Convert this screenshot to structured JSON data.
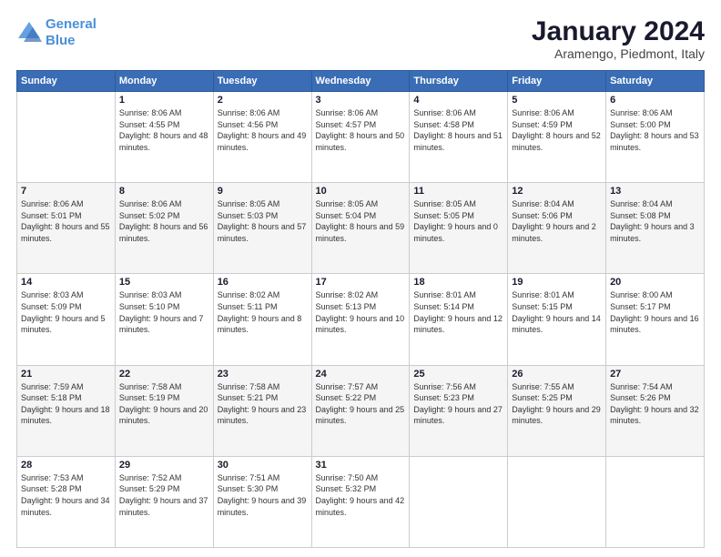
{
  "logo": {
    "line1": "General",
    "line2": "Blue"
  },
  "title": "January 2024",
  "subtitle": "Aramengo, Piedmont, Italy",
  "weekdays": [
    "Sunday",
    "Monday",
    "Tuesday",
    "Wednesday",
    "Thursday",
    "Friday",
    "Saturday"
  ],
  "weeks": [
    [
      {
        "day": "",
        "sunrise": "",
        "sunset": "",
        "daylight": ""
      },
      {
        "day": "1",
        "sunrise": "Sunrise: 8:06 AM",
        "sunset": "Sunset: 4:55 PM",
        "daylight": "Daylight: 8 hours and 48 minutes."
      },
      {
        "day": "2",
        "sunrise": "Sunrise: 8:06 AM",
        "sunset": "Sunset: 4:56 PM",
        "daylight": "Daylight: 8 hours and 49 minutes."
      },
      {
        "day": "3",
        "sunrise": "Sunrise: 8:06 AM",
        "sunset": "Sunset: 4:57 PM",
        "daylight": "Daylight: 8 hours and 50 minutes."
      },
      {
        "day": "4",
        "sunrise": "Sunrise: 8:06 AM",
        "sunset": "Sunset: 4:58 PM",
        "daylight": "Daylight: 8 hours and 51 minutes."
      },
      {
        "day": "5",
        "sunrise": "Sunrise: 8:06 AM",
        "sunset": "Sunset: 4:59 PM",
        "daylight": "Daylight: 8 hours and 52 minutes."
      },
      {
        "day": "6",
        "sunrise": "Sunrise: 8:06 AM",
        "sunset": "Sunset: 5:00 PM",
        "daylight": "Daylight: 8 hours and 53 minutes."
      }
    ],
    [
      {
        "day": "7",
        "sunrise": "Sunrise: 8:06 AM",
        "sunset": "Sunset: 5:01 PM",
        "daylight": "Daylight: 8 hours and 55 minutes."
      },
      {
        "day": "8",
        "sunrise": "Sunrise: 8:06 AM",
        "sunset": "Sunset: 5:02 PM",
        "daylight": "Daylight: 8 hours and 56 minutes."
      },
      {
        "day": "9",
        "sunrise": "Sunrise: 8:05 AM",
        "sunset": "Sunset: 5:03 PM",
        "daylight": "Daylight: 8 hours and 57 minutes."
      },
      {
        "day": "10",
        "sunrise": "Sunrise: 8:05 AM",
        "sunset": "Sunset: 5:04 PM",
        "daylight": "Daylight: 8 hours and 59 minutes."
      },
      {
        "day": "11",
        "sunrise": "Sunrise: 8:05 AM",
        "sunset": "Sunset: 5:05 PM",
        "daylight": "Daylight: 9 hours and 0 minutes."
      },
      {
        "day": "12",
        "sunrise": "Sunrise: 8:04 AM",
        "sunset": "Sunset: 5:06 PM",
        "daylight": "Daylight: 9 hours and 2 minutes."
      },
      {
        "day": "13",
        "sunrise": "Sunrise: 8:04 AM",
        "sunset": "Sunset: 5:08 PM",
        "daylight": "Daylight: 9 hours and 3 minutes."
      }
    ],
    [
      {
        "day": "14",
        "sunrise": "Sunrise: 8:03 AM",
        "sunset": "Sunset: 5:09 PM",
        "daylight": "Daylight: 9 hours and 5 minutes."
      },
      {
        "day": "15",
        "sunrise": "Sunrise: 8:03 AM",
        "sunset": "Sunset: 5:10 PM",
        "daylight": "Daylight: 9 hours and 7 minutes."
      },
      {
        "day": "16",
        "sunrise": "Sunrise: 8:02 AM",
        "sunset": "Sunset: 5:11 PM",
        "daylight": "Daylight: 9 hours and 8 minutes."
      },
      {
        "day": "17",
        "sunrise": "Sunrise: 8:02 AM",
        "sunset": "Sunset: 5:13 PM",
        "daylight": "Daylight: 9 hours and 10 minutes."
      },
      {
        "day": "18",
        "sunrise": "Sunrise: 8:01 AM",
        "sunset": "Sunset: 5:14 PM",
        "daylight": "Daylight: 9 hours and 12 minutes."
      },
      {
        "day": "19",
        "sunrise": "Sunrise: 8:01 AM",
        "sunset": "Sunset: 5:15 PM",
        "daylight": "Daylight: 9 hours and 14 minutes."
      },
      {
        "day": "20",
        "sunrise": "Sunrise: 8:00 AM",
        "sunset": "Sunset: 5:17 PM",
        "daylight": "Daylight: 9 hours and 16 minutes."
      }
    ],
    [
      {
        "day": "21",
        "sunrise": "Sunrise: 7:59 AM",
        "sunset": "Sunset: 5:18 PM",
        "daylight": "Daylight: 9 hours and 18 minutes."
      },
      {
        "day": "22",
        "sunrise": "Sunrise: 7:58 AM",
        "sunset": "Sunset: 5:19 PM",
        "daylight": "Daylight: 9 hours and 20 minutes."
      },
      {
        "day": "23",
        "sunrise": "Sunrise: 7:58 AM",
        "sunset": "Sunset: 5:21 PM",
        "daylight": "Daylight: 9 hours and 23 minutes."
      },
      {
        "day": "24",
        "sunrise": "Sunrise: 7:57 AM",
        "sunset": "Sunset: 5:22 PM",
        "daylight": "Daylight: 9 hours and 25 minutes."
      },
      {
        "day": "25",
        "sunrise": "Sunrise: 7:56 AM",
        "sunset": "Sunset: 5:23 PM",
        "daylight": "Daylight: 9 hours and 27 minutes."
      },
      {
        "day": "26",
        "sunrise": "Sunrise: 7:55 AM",
        "sunset": "Sunset: 5:25 PM",
        "daylight": "Daylight: 9 hours and 29 minutes."
      },
      {
        "day": "27",
        "sunrise": "Sunrise: 7:54 AM",
        "sunset": "Sunset: 5:26 PM",
        "daylight": "Daylight: 9 hours and 32 minutes."
      }
    ],
    [
      {
        "day": "28",
        "sunrise": "Sunrise: 7:53 AM",
        "sunset": "Sunset: 5:28 PM",
        "daylight": "Daylight: 9 hours and 34 minutes."
      },
      {
        "day": "29",
        "sunrise": "Sunrise: 7:52 AM",
        "sunset": "Sunset: 5:29 PM",
        "daylight": "Daylight: 9 hours and 37 minutes."
      },
      {
        "day": "30",
        "sunrise": "Sunrise: 7:51 AM",
        "sunset": "Sunset: 5:30 PM",
        "daylight": "Daylight: 9 hours and 39 minutes."
      },
      {
        "day": "31",
        "sunrise": "Sunrise: 7:50 AM",
        "sunset": "Sunset: 5:32 PM",
        "daylight": "Daylight: 9 hours and 42 minutes."
      },
      {
        "day": "",
        "sunrise": "",
        "sunset": "",
        "daylight": ""
      },
      {
        "day": "",
        "sunrise": "",
        "sunset": "",
        "daylight": ""
      },
      {
        "day": "",
        "sunrise": "",
        "sunset": "",
        "daylight": ""
      }
    ]
  ]
}
